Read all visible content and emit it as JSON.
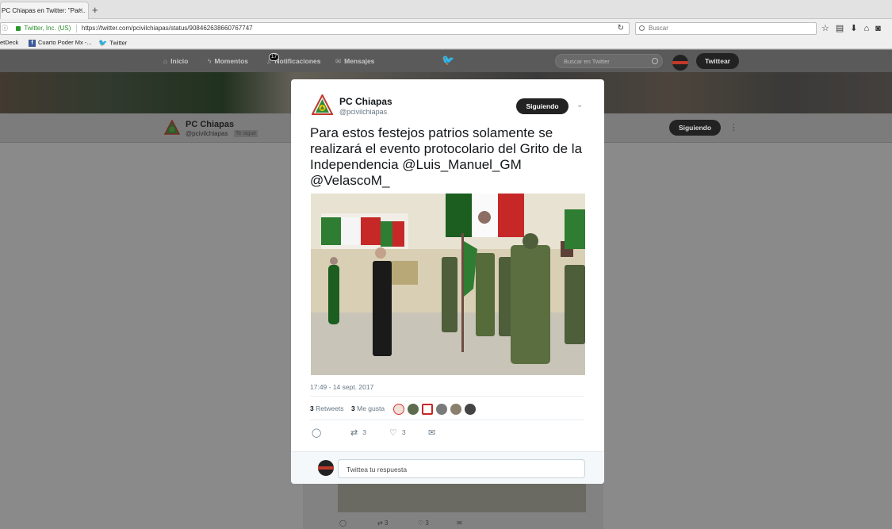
{
  "browser": {
    "tab_title": "PC Chiapas en Twitter: \"Par...",
    "tab_close": "×",
    "new_tab": "+",
    "url_secure": "Twitter, Inc. (US)",
    "url": "https://twitter.com/pcivilchiapas/status/908462638660767747",
    "search_placeholder": "Buscar",
    "bookmarks": [
      "etDeck",
      "Cuarto Poder Mx -...",
      "Twitter"
    ]
  },
  "twitter_nav": {
    "items": [
      "Inicio",
      "Momentos",
      "Notificaciones",
      "Mensajes"
    ],
    "notif_count": "17",
    "search_placeholder": "Buscar en Twitter",
    "tweet_button": "Twittear"
  },
  "profile": {
    "name": "PC Chiapas",
    "handle": "@pcivilchiapas",
    "follows_you": "Te sigue",
    "follow_button": "Siguiendo"
  },
  "tweet": {
    "name": "PC Chiapas",
    "handle": "@pcivilchiapas",
    "follow_button": "Siguiendo",
    "text": "Para estos festejos patrios solamente se realizará el evento protocolario del Grito de la Independencia @Luis_Manuel_GM @VelascoM_",
    "timestamp": "17:49 - 14 sept. 2017",
    "retweets_count": "3",
    "retweets_label": "Retweets",
    "likes_count": "3",
    "likes_label": "Me gusta",
    "action_retweets": "3",
    "action_likes": "3",
    "reply_placeholder": "Twittea tu respuesta"
  },
  "background_tweet": {
    "retweets": "3",
    "likes": "3"
  },
  "colors": {
    "twitter_blue": "#1da1f2",
    "follow_button": "#222222",
    "logo_green": "#2e8b3a",
    "logo_red": "#c0392b"
  }
}
